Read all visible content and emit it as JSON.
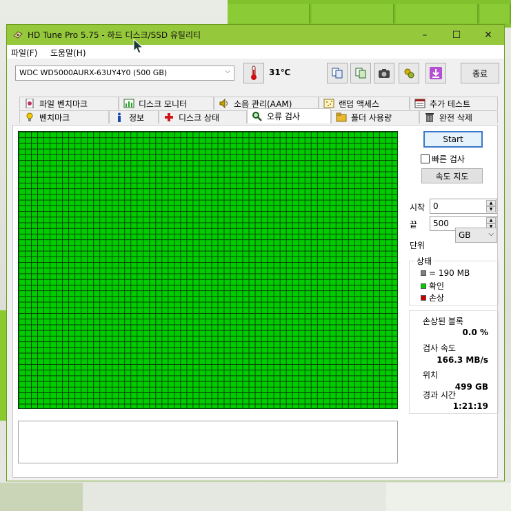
{
  "window": {
    "title": "HD Tune Pro 5.75 - 하드 디스크/SSD 유틸리티"
  },
  "controls": {
    "minimize": "–",
    "maximize": "☐",
    "close": "✕"
  },
  "menu": {
    "file": "파일(F)",
    "help": "도움말(H)"
  },
  "toolbar": {
    "drive": "WDC WD5000AURX-63UY4Y0 (500 GB)",
    "temperature": "31℃",
    "exit": "종료"
  },
  "tabs_top": [
    "파일 벤치마크",
    "디스크 모니터",
    "소음 관리(AAM)",
    "랜덤 액세스",
    "추가 테스트"
  ],
  "tabs_bottom": [
    "벤치마크",
    "정보",
    "디스크 상태",
    "오류 검사",
    "폴더 사용량",
    "완전 삭제"
  ],
  "active_tab": "오류 검사",
  "scan": {
    "start_label": "Start",
    "quick_scan": "빠른 검사",
    "speed_map": "속도 지도",
    "start_label_text": "시작",
    "start_value": "0",
    "end_label_text": "끝",
    "end_value": "500",
    "unit_label": "단위",
    "unit_value": "GB"
  },
  "status": {
    "title": "상태",
    "legend_block": "= 190 MB",
    "legend_ok": "확인",
    "legend_damaged": "손상",
    "colors": {
      "block": "#808080",
      "ok": "#00cc00",
      "damaged": "#cc0000"
    }
  },
  "stats": {
    "damaged_label": "손상된 블록",
    "damaged_value": "0.0 %",
    "speed_label": "검사 속도",
    "speed_value": "166.3 MB/s",
    "position_label": "위치",
    "position_value": "499 GB",
    "elapsed_label": "경과 시간",
    "elapsed_value": "1:21:19"
  }
}
